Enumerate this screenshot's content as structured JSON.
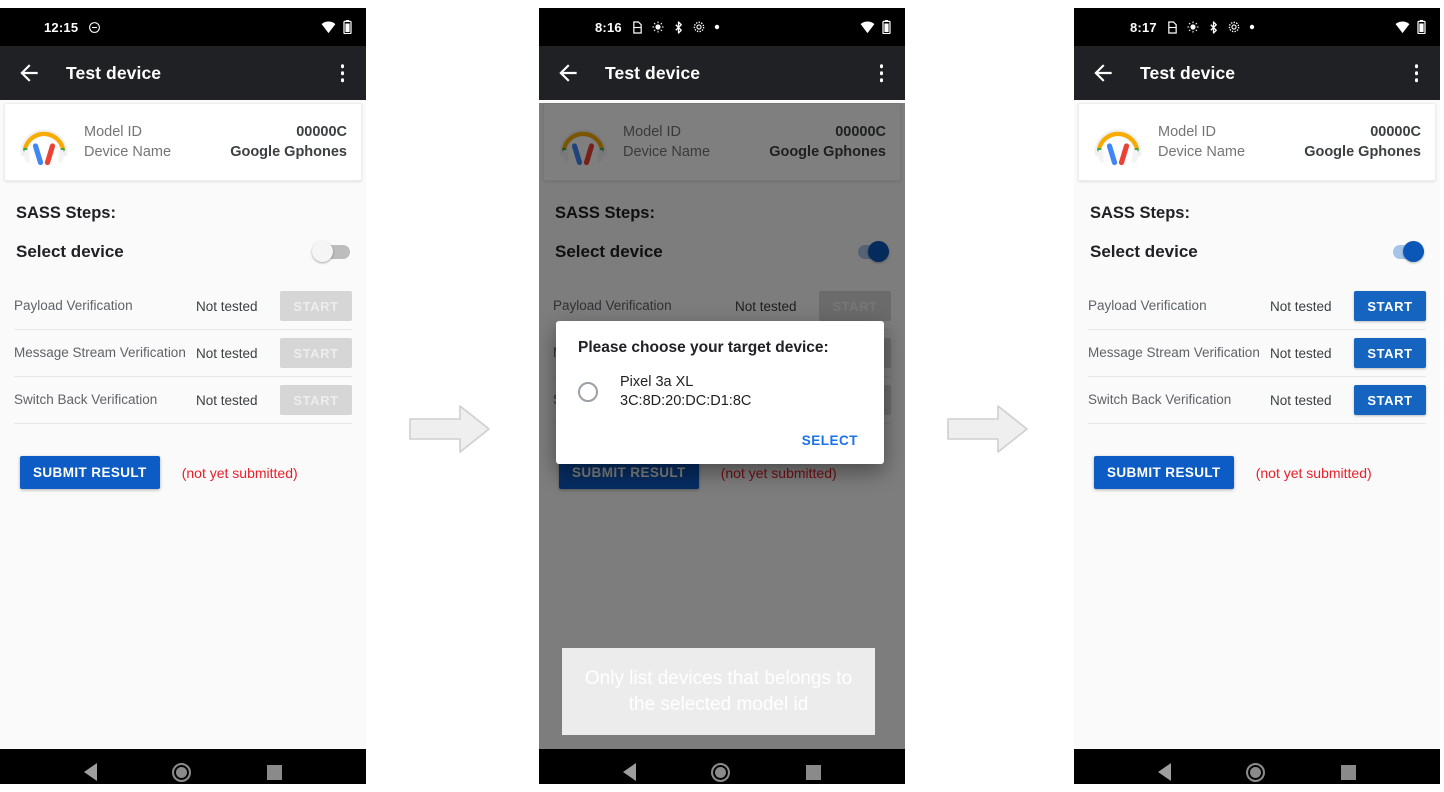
{
  "panels": [
    {
      "id": "panel-initial",
      "status_bar": {
        "time": "12:15",
        "icons": [
          "sim-icon",
          "wifi-icon",
          "battery-icon"
        ],
        "left_extra": [
          "do-not-disturb-icon"
        ]
      },
      "app_bar": {
        "title": "Test device",
        "back_icon": "back-arrow-icon",
        "overflow_icon": "overflow-menu-icon"
      },
      "device_card": {
        "icon": "headphones-icon",
        "rows": [
          {
            "key": "Model ID",
            "value": "00000C"
          },
          {
            "key": "Device Name",
            "value": "Google Gphones"
          }
        ]
      },
      "section_title": "SASS Steps:",
      "select_device": {
        "label": "Select device",
        "toggle_on": false
      },
      "tests": [
        {
          "name": "Payload Verification",
          "status": "Not tested",
          "button": "START",
          "enabled": false
        },
        {
          "name": "Message Stream Verification",
          "status": "Not tested",
          "button": "START",
          "enabled": false
        },
        {
          "name": "Switch Back Verification",
          "status": "Not tested",
          "button": "START",
          "enabled": false
        }
      ],
      "submit": {
        "label": "SUBMIT RESULT",
        "note": "(not yet submitted)"
      },
      "nav": {
        "back": "nav-back-icon",
        "home": "nav-home-icon",
        "recents": "nav-recents-icon"
      },
      "dialog": null,
      "annotation": null
    },
    {
      "id": "panel-dialog",
      "status_bar": {
        "time": "8:16",
        "icons": [
          "sim-icon",
          "wifi-icon",
          "battery-icon"
        ],
        "left_extra": [
          "sim-icon",
          "brightness-icon",
          "bluetooth-icon",
          "settings-icon",
          "dot-icon"
        ]
      },
      "app_bar": {
        "title": "Test device",
        "back_icon": "back-arrow-icon",
        "overflow_icon": "overflow-menu-icon"
      },
      "device_card": {
        "icon": "headphones-icon",
        "rows": [
          {
            "key": "Model ID",
            "value": "00000C"
          },
          {
            "key": "Device Name",
            "value": "Google Gphones"
          }
        ]
      },
      "section_title": "SASS Steps:",
      "select_device": {
        "label": "Select device",
        "toggle_on": true
      },
      "tests": [
        {
          "name": "Payload Verification",
          "status": "Not tested",
          "button": "START",
          "enabled": false
        },
        {
          "name": "Message Stream Verification",
          "status": "Not tested",
          "button": "START",
          "enabled": false
        },
        {
          "name": "Switch Back Verification",
          "status": "Not tested",
          "button": "START",
          "enabled": false
        }
      ],
      "submit": {
        "label": "SUBMIT RESULT",
        "note": "(not yet submitted)"
      },
      "nav": {
        "back": "nav-back-icon",
        "home": "nav-home-icon",
        "recents": "nav-recents-icon"
      },
      "dialog": {
        "title": "Please choose your target device:",
        "options": [
          {
            "name": "Pixel 3a XL",
            "address": "3C:8D:20:DC:D1:8C",
            "selected": false
          }
        ],
        "action": "SELECT"
      },
      "annotation": "Only list devices that belongs to the selected model id"
    },
    {
      "id": "panel-selected",
      "status_bar": {
        "time": "8:17",
        "icons": [
          "sim-icon",
          "wifi-icon",
          "battery-icon"
        ],
        "left_extra": [
          "sim-icon",
          "brightness-icon",
          "bluetooth-icon",
          "settings-icon",
          "dot-icon"
        ]
      },
      "app_bar": {
        "title": "Test device",
        "back_icon": "back-arrow-icon",
        "overflow_icon": "overflow-menu-icon"
      },
      "device_card": {
        "icon": "headphones-icon",
        "rows": [
          {
            "key": "Model ID",
            "value": "00000C"
          },
          {
            "key": "Device Name",
            "value": "Google Gphones"
          }
        ]
      },
      "section_title": "SASS Steps:",
      "select_device": {
        "label": "Select device",
        "toggle_on": true
      },
      "tests": [
        {
          "name": "Payload Verification",
          "status": "Not tested",
          "button": "START",
          "enabled": true
        },
        {
          "name": "Message Stream Verification",
          "status": "Not tested",
          "button": "START",
          "enabled": true
        },
        {
          "name": "Switch Back Verification",
          "status": "Not tested",
          "button": "START",
          "enabled": true
        }
      ],
      "submit": {
        "label": "SUBMIT RESULT",
        "note": "(not yet submitted)"
      },
      "nav": {
        "back": "nav-back-icon",
        "home": "nav-home-icon",
        "recents": "nav-recents-icon"
      },
      "dialog": null,
      "annotation": null
    }
  ],
  "flow_arrows": [
    {
      "name": "flow-arrow-1",
      "direction": "right"
    },
    {
      "name": "flow-arrow-2",
      "direction": "right"
    }
  ],
  "colors": {
    "primary_blue": "#0d5bc4",
    "start_enabled_blue": "#1565c0",
    "toggle_on_blue": "#0b57b8",
    "select_link_blue": "#1a73e8",
    "error_red": "#e8202a",
    "appbar_dark": "#202124",
    "page_background": "#fafafa",
    "annotation_background": "#ececec"
  }
}
